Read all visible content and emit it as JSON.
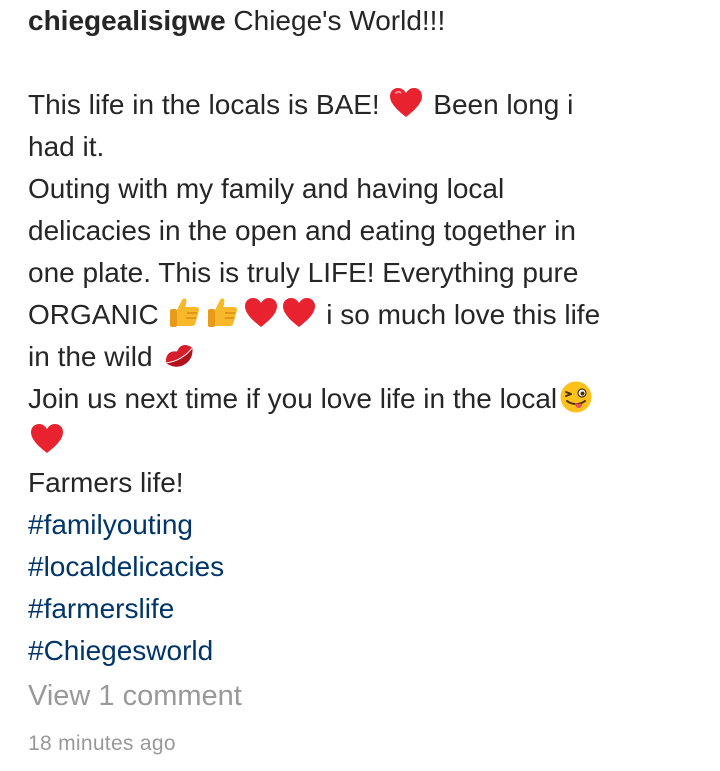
{
  "post": {
    "username": "chiegealisigwe",
    "caption_title": " Chiege's World!!!",
    "lines": {
      "l1a": "This life in the locals is BAE! ",
      "l1b": " Been long i",
      "l2": "had it.",
      "l3": "Outing with my family and having local",
      "l4": "delicacies in the open and eating together in",
      "l5": "one plate. This is truly LIFE! Everything pure",
      "l6a": "ORGANIC ",
      "l6b": " i so much love this life",
      "l7": "in the wild ",
      "l8": "Join us next time if you love life in the local",
      "l10": "Farmers life!"
    },
    "hashtags": [
      "#familyouting",
      "#localdelicacies",
      "#farmerslife",
      "#Chiegesworld"
    ],
    "view_comments": "View 1 comment",
    "timestamp": "18 minutes ago"
  },
  "icons": {
    "heart": "red-heart-icon",
    "thumbs": "thumbs-up-icon",
    "kiss": "kiss-mark-icon",
    "wink": "winking-tongue-face-icon"
  },
  "colors": {
    "text": "#262626",
    "hashtag": "#003569",
    "muted": "#999999",
    "heart": "#e8222e",
    "thumbs": "#f7b829"
  }
}
